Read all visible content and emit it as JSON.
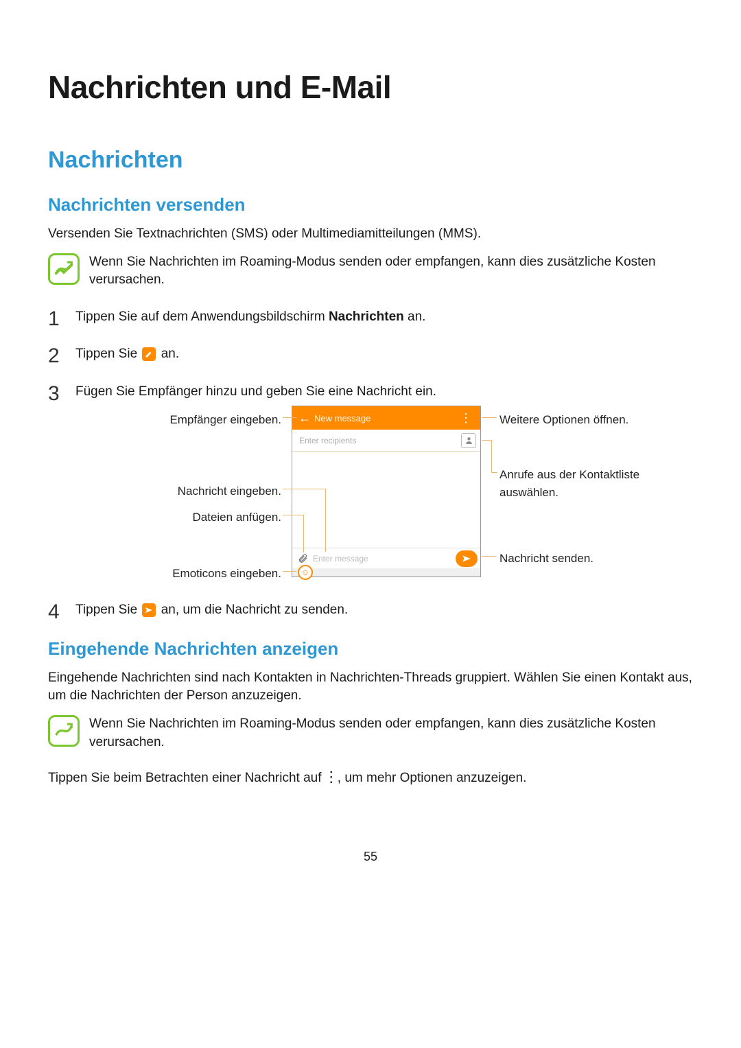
{
  "chapter_title": "Nachrichten und E-Mail",
  "section_title": "Nachrichten",
  "sub1_title": "Nachrichten versenden",
  "intro": "Versenden Sie Textnachrichten (SMS) oder Multimediamitteilungen (MMS).",
  "note1": "Wenn Sie Nachrichten im Roaming-Modus senden oder empfangen, kann dies zusätzliche Kosten verursachen.",
  "step1_a": "Tippen Sie auf dem Anwendungsbildschirm ",
  "step1_b": "Nachrichten",
  "step1_c": " an.",
  "step2_a": "Tippen Sie ",
  "step2_b": " an.",
  "step3": "Fügen Sie Empfänger hinzu und geben Sie eine Nachricht ein.",
  "step4_a": "Tippen Sie ",
  "step4_b": " an, um die Nachricht zu senden.",
  "callouts": {
    "left1": "Empfänger eingeben.",
    "left2": "Nachricht eingeben.",
    "left3": "Dateien anfügen.",
    "left4": "Emoticons eingeben.",
    "right1": "Weitere Optionen öffnen.",
    "right2": "Anrufe aus der Kontaktliste auswählen.",
    "right3": "Nachricht senden."
  },
  "phone": {
    "title": "New message",
    "recipients_placeholder": "Enter recipients",
    "message_placeholder": "Enter message"
  },
  "sub2_title": "Eingehende Nachrichten anzeigen",
  "sub2_p1": "Eingehende Nachrichten sind nach Kontakten in Nachrichten-Threads gruppiert. Wählen Sie einen Kontakt aus, um die Nachrichten der Person anzuzeigen.",
  "note2": "Wenn Sie Nachrichten im Roaming-Modus senden oder empfangen, kann dies zusätzliche Kosten verursachen.",
  "sub2_p2_a": "Tippen Sie beim Betrachten einer Nachricht auf ",
  "sub2_p2_b": ", um mehr Optionen anzuzeigen.",
  "page_number": "55",
  "nums": {
    "n1": "1",
    "n2": "2",
    "n3": "3",
    "n4": "4"
  }
}
